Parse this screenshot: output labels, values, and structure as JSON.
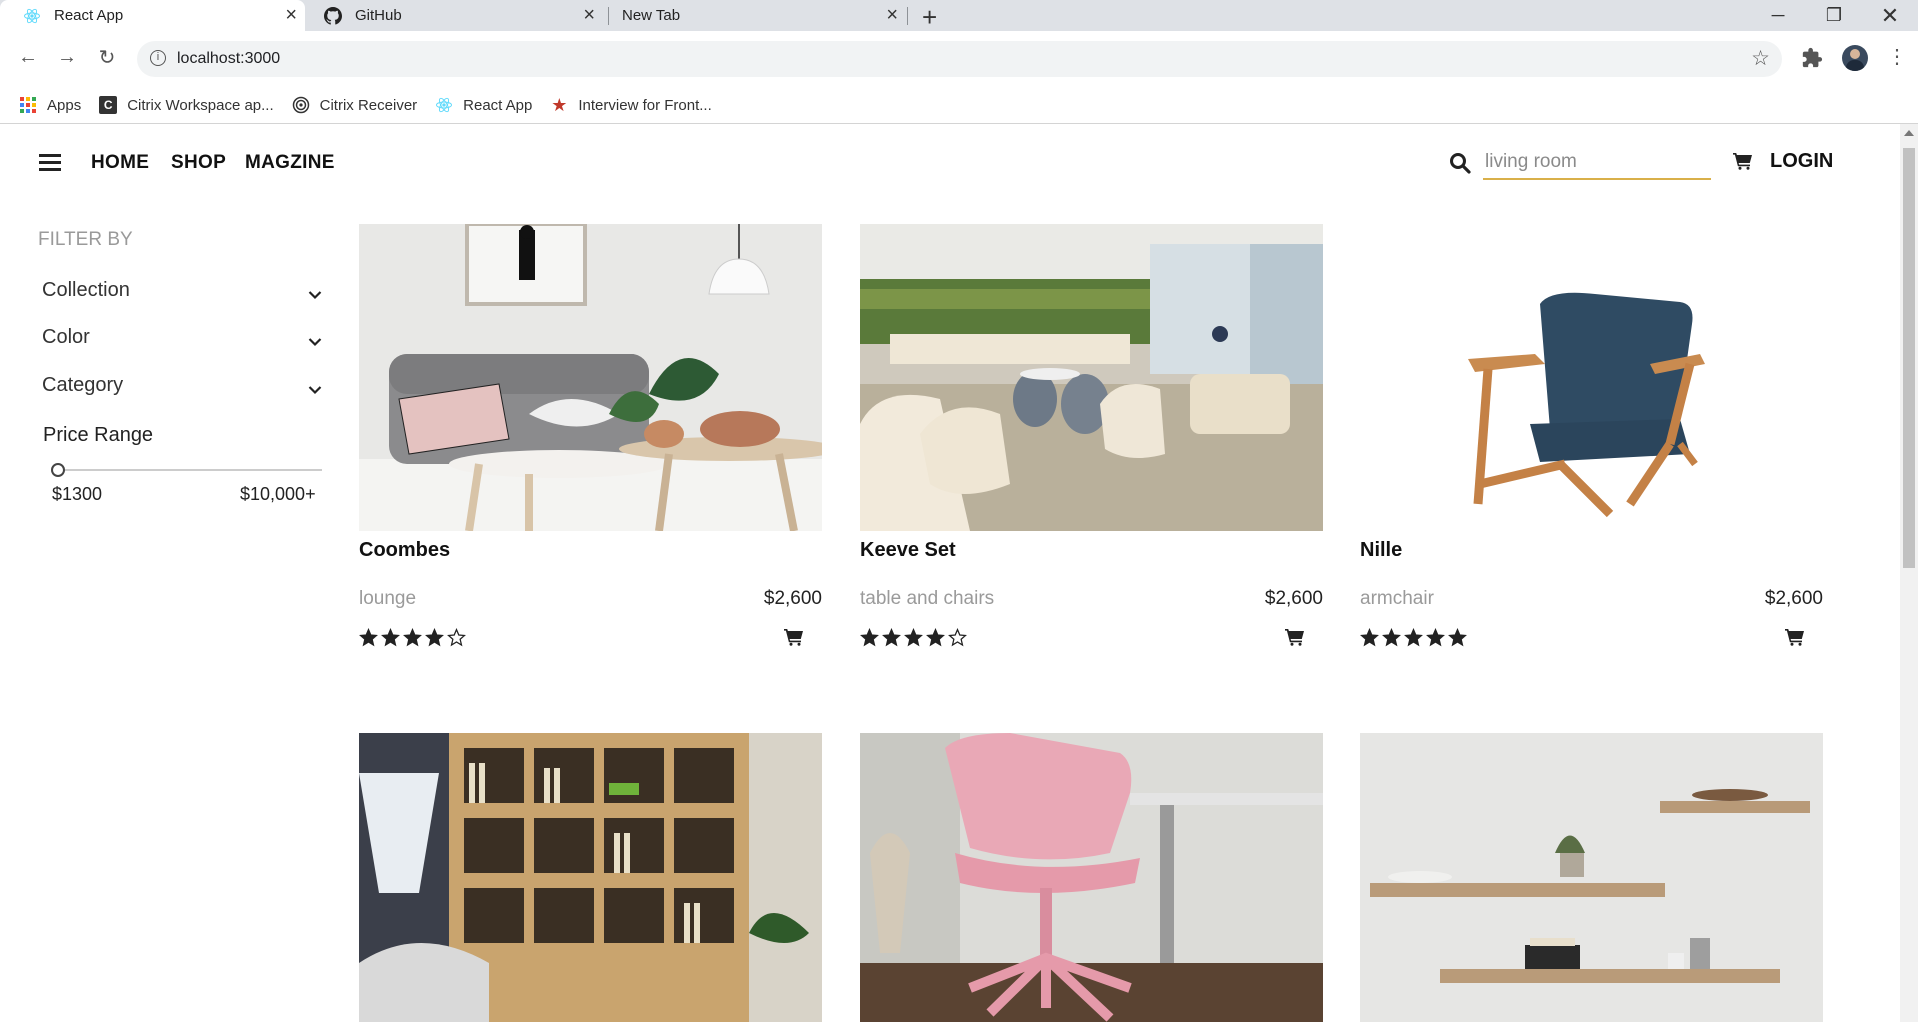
{
  "browser": {
    "tabs": [
      {
        "title": "React App",
        "icon": "react-icon",
        "active": true
      },
      {
        "title": "GitHub",
        "icon": "github-icon",
        "active": false
      },
      {
        "title": "New Tab",
        "icon": "",
        "active": false
      }
    ],
    "url": "localhost:3000",
    "bookmarks": [
      {
        "label": "Apps",
        "icon": "apps-grid-icon"
      },
      {
        "label": "Citrix Workspace ap...",
        "icon": "citrix-icon"
      },
      {
        "label": "Citrix Receiver",
        "icon": "citrix-receiver-icon"
      },
      {
        "label": "React App",
        "icon": "react-icon"
      },
      {
        "label": "Interview for Front...",
        "icon": "star-icon"
      }
    ]
  },
  "header": {
    "nav": [
      "HOME",
      "SHOP",
      "MAGZINE"
    ],
    "search_value": "living room",
    "login_label": "LOGIN"
  },
  "filters": {
    "title": "FILTER BY",
    "groups": [
      "Collection",
      "Color",
      "Category"
    ],
    "price_range_label": "Price Range",
    "price_min": "$1300",
    "price_max": "$10,000+",
    "slider_value": 0
  },
  "products": [
    {
      "name": "Coombes",
      "category": "lounge",
      "price": "$2,600",
      "rating": 4,
      "image": "living-room-sofa"
    },
    {
      "name": "Keeve Set",
      "category": "table and chairs",
      "price": "$2,600",
      "rating": 4,
      "image": "lounge-chairs"
    },
    {
      "name": "Nille",
      "category": "armchair",
      "price": "$2,600",
      "rating": 5,
      "image": "armchair"
    },
    {
      "name": "",
      "category": "",
      "price": "",
      "rating": null,
      "image": "bookshelf"
    },
    {
      "name": "",
      "category": "",
      "price": "",
      "rating": null,
      "image": "pink-office-chair"
    },
    {
      "name": "",
      "category": "",
      "price": "",
      "rating": null,
      "image": "wall-shelves"
    }
  ],
  "colors": {
    "accent": "#d9b04a",
    "text": "#111111",
    "muted": "#9a9a9a"
  }
}
